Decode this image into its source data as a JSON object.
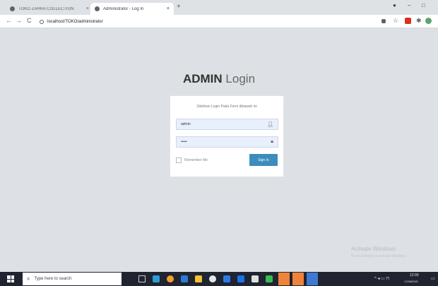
{
  "browser": {
    "tabs": [
      {
        "title": "TOKO ZAHRA COLLECTION",
        "close": "×"
      },
      {
        "title": "Administrator - Log In",
        "close": "×"
      }
    ],
    "new_tab": "+",
    "window_controls": {
      "minimize": "–",
      "maximize": "□"
    },
    "nav": {
      "back": "←",
      "forward": "→",
      "reload": "C"
    },
    "url": "localhost/TOKO/administrator",
    "extensions": [
      "key-icon",
      "star-icon",
      "red-extension-icon",
      "puzzle-icon",
      "profile-avatar-icon"
    ]
  },
  "login": {
    "heading_bold": "ADMIN",
    "heading_light": "Login",
    "prompt": "Silahkan Login Pada Form dibawah ini",
    "username_value": "admin",
    "password_value": "•••••",
    "remember_label": "Remember Me",
    "signin_label": "Sign In"
  },
  "watermark": {
    "line1": "Activate Windows",
    "line2": "Go to Settings to activate Windows."
  },
  "taskbar": {
    "search_placeholder": "Type here to search",
    "time": "12:00",
    "date": "17/08/2021",
    "tray": "^ ◂ ▭ ⊓"
  },
  "colors": {
    "page_bg": "#dde0e5",
    "signin_bg": "#3c8dbc",
    "field_bg": "#e8f0fe",
    "taskbar_bg": "#1f2430"
  }
}
